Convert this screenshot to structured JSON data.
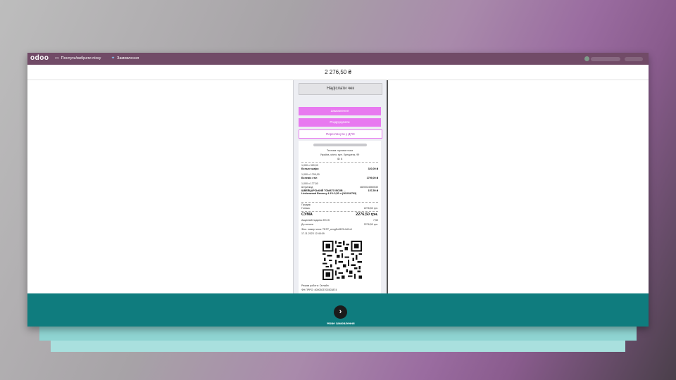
{
  "app": {
    "logo": "odoo"
  },
  "nav": {
    "products_label": "Послуги/вибрати піску",
    "orders_label": "Замовлення"
  },
  "order": {
    "total": "2 276,50 ₴"
  },
  "panel": {
    "print_label": "Надіслати чек",
    "btn1_label": "Замовлення",
    "btn2_label": "Роздрукувати",
    "btn3_label": "Переглянути у ДПС"
  },
  "receipt": {
    "store_name": "Тестова торгова точка",
    "store_address": "Україна, місто, вул. Хрещатик, 99",
    "store_id": "ID: 8",
    "lines": [
      {
        "qty": "1,000 x 320,00",
        "name": "Бельне шафо",
        "amount": "320,00 ₴"
      },
      {
        "qty": "1,000 x 1799,00",
        "name": "Белеміс стіл",
        "amount": "1799,00 ₴"
      },
      {
        "qty": "1,000 x 177,50",
        "name": "Штрихкод",
        "amount": "4820024560530"
      }
    ],
    "item3_desc": "ШВЕЙЦАРСЬКИЙ TOMATO ВОЗВ ... Lindenwood Brewery 4.1% 0,50 л (161016793)",
    "item3_amount": "157,50 ₴",
    "sales_label": "Продаж",
    "cash_label": "Готівка",
    "cash_amount": "2276,50 грн.",
    "sum_label": "СУМА",
    "sum_amount": "2276,50 грн.",
    "excise_label": "Акцизний податок 5% Ж",
    "excise_amount": "7,50",
    "topay_label": "До сплати",
    "topay_amount": "2276,50 грн.",
    "fiscal_label": "Фіск. номер чека: TEST_wmgDz9EGUhGnX",
    "datetime": "17.11.2023 12:45:09",
    "mode_label": "Режим роботи: Онлайн",
    "rro_label": "ФН ПРРО: 4000303700303874"
  },
  "footer": {
    "next_label": "Нове замовлення"
  },
  "colors": {
    "topbar": "#714b67",
    "accent": "#e879f0",
    "footer": "#0f7c7e"
  }
}
